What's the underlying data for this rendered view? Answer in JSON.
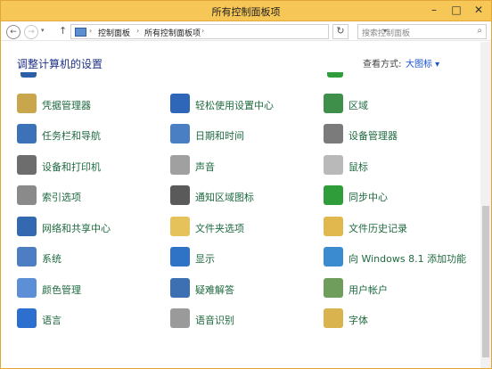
{
  "window": {
    "title": "所有控制面板项",
    "controls": [
      "–",
      "□",
      "✕"
    ]
  },
  "address": {
    "breadcrumbs": [
      "控制面板",
      "所有控制面板项"
    ],
    "search_placeholder": "搜索控制面板"
  },
  "header": {
    "heading": "调整计算机的设置",
    "view_by_label": "查看方式:",
    "view_by_value": "大图标 ▾"
  },
  "items": [
    {
      "label": "凭据管理器",
      "icon": "credential-icon",
      "color": "#c9a64b"
    },
    {
      "label": "轻松使用设置中心",
      "icon": "ease-of-access-icon",
      "color": "#2e67b8"
    },
    {
      "label": "区域",
      "icon": "region-icon",
      "color": "#3d8f4a"
    },
    {
      "label": "任务栏和导航",
      "icon": "taskbar-icon",
      "color": "#3e72b8"
    },
    {
      "label": "日期和时间",
      "icon": "calendar-icon",
      "color": "#4b7fc4"
    },
    {
      "label": "设备管理器",
      "icon": "device-manager-icon",
      "color": "#7b7b7b"
    },
    {
      "label": "设备和打印机",
      "icon": "printer-icon",
      "color": "#6d6d6d"
    },
    {
      "label": "声音",
      "icon": "speaker-icon",
      "color": "#a0a0a0"
    },
    {
      "label": "鼠标",
      "icon": "mouse-icon",
      "color": "#b9b9b9"
    },
    {
      "label": "索引选项",
      "icon": "indexing-icon",
      "color": "#8a8a8a"
    },
    {
      "label": "通知区域图标",
      "icon": "notification-icon",
      "color": "#5a5a5a"
    },
    {
      "label": "同步中心",
      "icon": "sync-icon",
      "color": "#2f9e3a"
    },
    {
      "label": "网络和共享中心",
      "icon": "network-icon",
      "color": "#3468b0"
    },
    {
      "label": "文件夹选项",
      "icon": "folder-options-icon",
      "color": "#e5c25a"
    },
    {
      "label": "文件历史记录",
      "icon": "file-history-icon",
      "color": "#e0b84d"
    },
    {
      "label": "系统",
      "icon": "system-icon",
      "color": "#4d7ec4"
    },
    {
      "label": "显示",
      "icon": "display-icon",
      "color": "#2f73c7"
    },
    {
      "label": "向 Windows 8.1 添加功能",
      "icon": "add-features-icon",
      "color": "#3b8bd0"
    },
    {
      "label": "颜色管理",
      "icon": "color-management-icon",
      "color": "#5c8fd6"
    },
    {
      "label": "疑难解答",
      "icon": "troubleshoot-icon",
      "color": "#3d6fb3"
    },
    {
      "label": "用户帐户",
      "icon": "user-accounts-icon",
      "color": "#6f9d5b"
    },
    {
      "label": "语言",
      "icon": "language-icon",
      "color": "#2c6fcf"
    },
    {
      "label": "语音识别",
      "icon": "microphone-icon",
      "color": "#9a9a9a"
    },
    {
      "label": "字体",
      "icon": "font-icon",
      "color": "#d9b44e"
    }
  ]
}
